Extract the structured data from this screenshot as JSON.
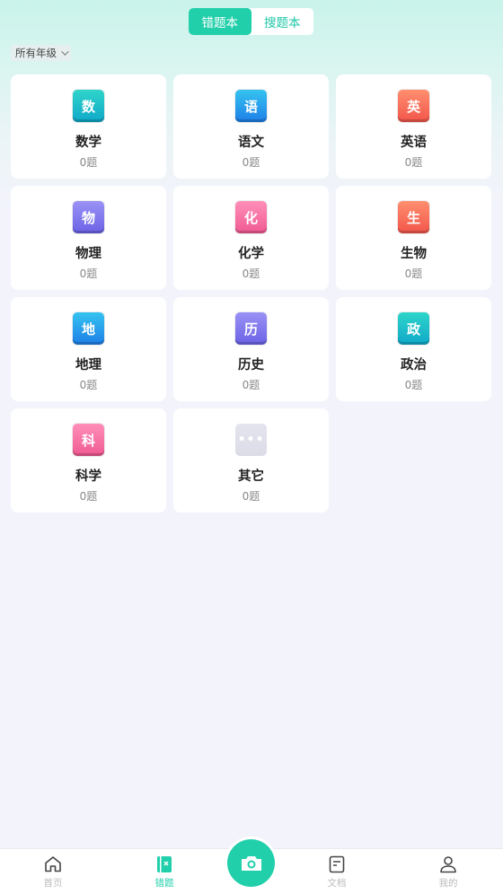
{
  "header": {
    "segments": [
      {
        "label": "错题本",
        "active": true
      },
      {
        "label": "搜题本",
        "active": false
      }
    ],
    "grade_filter": "所有年级"
  },
  "subjects": [
    {
      "badge": "数",
      "name": "数学",
      "count": "0题",
      "color_top": "#2fd5c9",
      "color_bottom": "#0fa8c9"
    },
    {
      "badge": "语",
      "name": "语文",
      "count": "0题",
      "color_top": "#35c3f0",
      "color_bottom": "#1e7fe8"
    },
    {
      "badge": "英",
      "name": "英语",
      "count": "0题",
      "color_top": "#ff8f6f",
      "color_bottom": "#f2554b"
    },
    {
      "badge": "物",
      "name": "物理",
      "count": "0题",
      "color_top": "#9a92f5",
      "color_bottom": "#6b62e6"
    },
    {
      "badge": "化",
      "name": "化学",
      "count": "0题",
      "color_top": "#ff8fb8",
      "color_bottom": "#f05a92"
    },
    {
      "badge": "生",
      "name": "生物",
      "count": "0题",
      "color_top": "#ff8f6f",
      "color_bottom": "#f2554b"
    },
    {
      "badge": "地",
      "name": "地理",
      "count": "0题",
      "color_top": "#35c3f0",
      "color_bottom": "#1e7fe8"
    },
    {
      "badge": "历",
      "name": "历史",
      "count": "0题",
      "color_top": "#9a92f5",
      "color_bottom": "#6b62e6"
    },
    {
      "badge": "政",
      "name": "政治",
      "count": "0题",
      "color_top": "#2fd5c9",
      "color_bottom": "#0fa8c9"
    },
    {
      "badge": "科",
      "name": "科学",
      "count": "0题",
      "color_top": "#ff8fb8",
      "color_bottom": "#f05a92"
    },
    {
      "badge": "•••",
      "name": "其它",
      "count": "0题",
      "color_top": "#e4e4ee",
      "color_bottom": "#dcdce8"
    }
  ],
  "tabbar": {
    "tabs": [
      {
        "label": "首页",
        "icon": "home-icon",
        "active": false
      },
      {
        "label": "错题",
        "icon": "notebook-icon",
        "active": true
      },
      {
        "label": "文档",
        "icon": "document-icon",
        "active": false
      },
      {
        "label": "我的",
        "icon": "user-icon",
        "active": false
      }
    ],
    "camera_icon": "camera-icon"
  },
  "colors": {
    "accent": "#22cfab",
    "inactive": "#bbbbbb"
  }
}
